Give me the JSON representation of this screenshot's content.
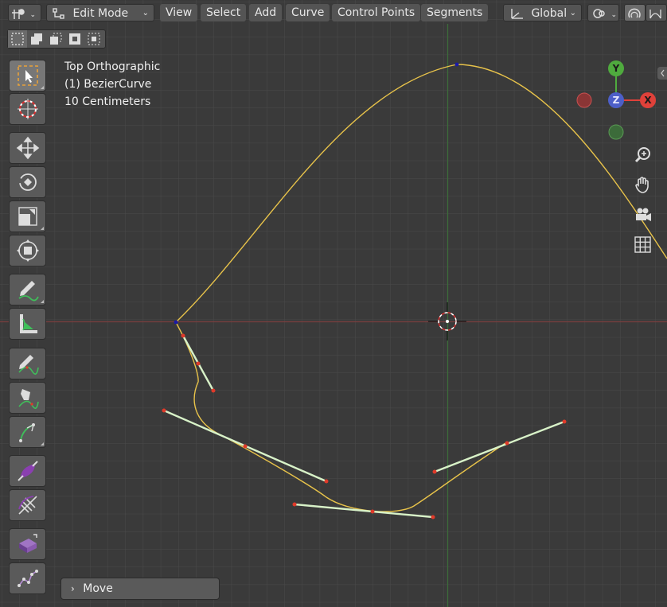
{
  "header": {
    "mode_label": "Edit Mode",
    "menus": [
      "View",
      "Select",
      "Add",
      "Curve",
      "Control Points",
      "Segments"
    ],
    "transform_orientation": "Global"
  },
  "overlay": {
    "view_name": "Top Orthographic",
    "object_name": "(1) BezierCurve",
    "grid_scale": "10 Centimeters"
  },
  "gizmo": {
    "y_label": "Y",
    "z_label": "Z",
    "x_label": "X"
  },
  "operator_panel": {
    "label": "Move"
  },
  "icons": [
    "editor-type-icon",
    "edit-mode-icon",
    "chevron-down-icon",
    "orientation-icon",
    "snap-icon",
    "proportional-edit-icon",
    "select-box-icon",
    "cursor-icon",
    "move-icon",
    "rotate-icon",
    "scale-icon",
    "transform-icon",
    "annotate-icon",
    "measure-icon",
    "draw-icon",
    "pen-icon",
    "curve-pen-icon",
    "radius-icon",
    "tilt-icon",
    "extrude-icon",
    "randomize-icon",
    "zoom-icon",
    "hand-icon",
    "camera-icon",
    "grid-icon"
  ],
  "colors": {
    "curve": "#e8c34a",
    "handle_line": "#d8f2c8",
    "handle_point": "#e03a2a",
    "x_axis": "#e0413a",
    "y_axis": "#4faa3e",
    "z_axis": "#4d5fc8"
  }
}
